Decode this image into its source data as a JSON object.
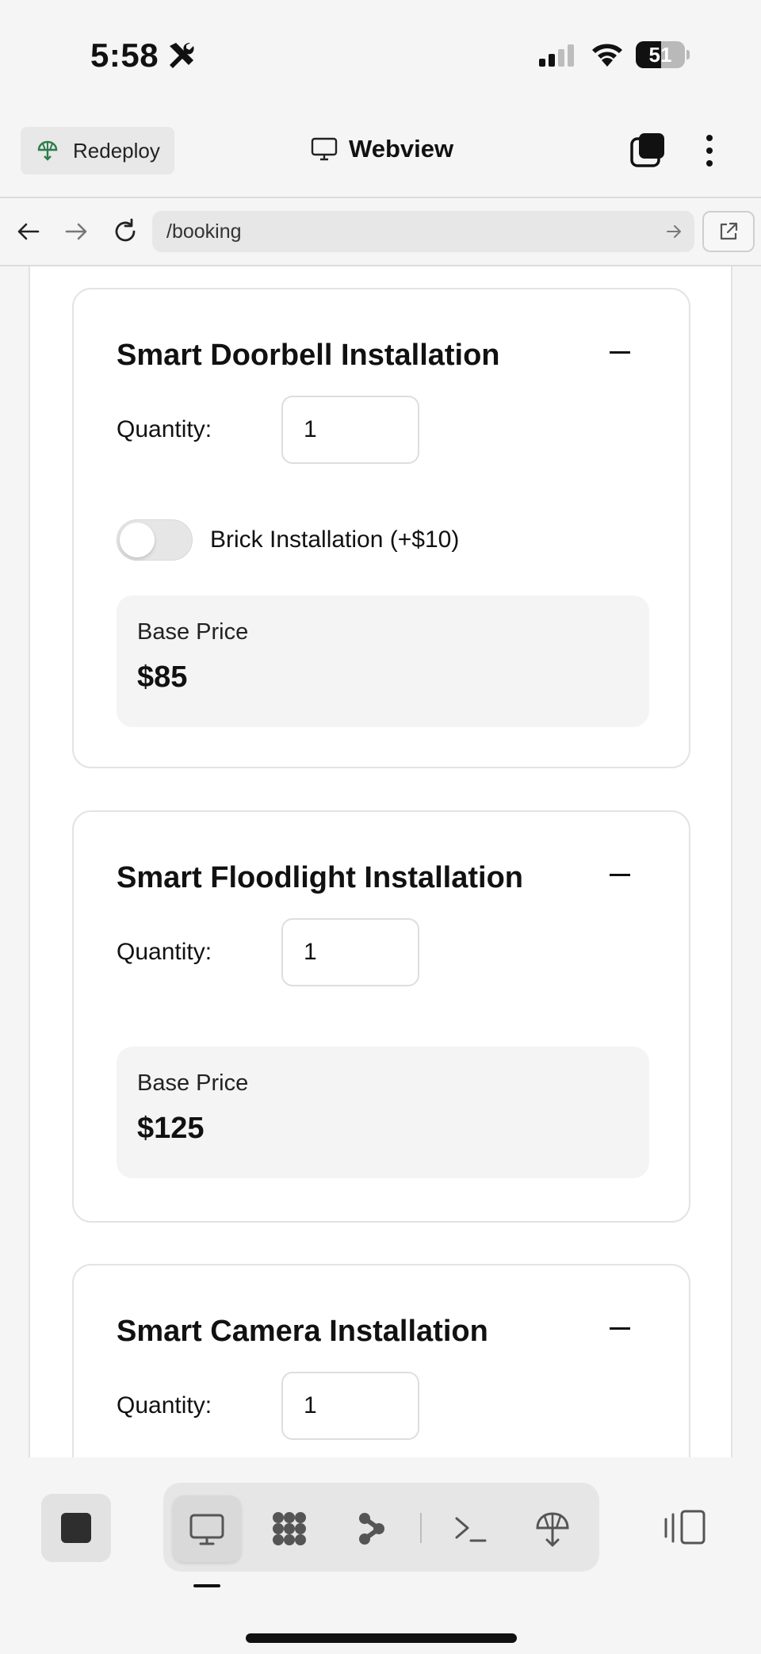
{
  "status_bar": {
    "time": "5:58",
    "battery": "51",
    "battery_level_percent": 51
  },
  "header": {
    "redeploy_label": "Redeploy",
    "title": "Webview"
  },
  "url_bar": {
    "url": "/booking"
  },
  "services": [
    {
      "title": "Smart Doorbell Installation",
      "quantity_label": "Quantity:",
      "quantity": "1",
      "option_label": "Brick Installation (+$10)",
      "option_enabled": false,
      "price_label": "Base Price",
      "price": "$85"
    },
    {
      "title": "Smart Floodlight Installation",
      "quantity_label": "Quantity:",
      "quantity": "1",
      "price_label": "Base Price",
      "price": "$125"
    },
    {
      "title": "Smart Camera Installation",
      "quantity_label": "Quantity:",
      "quantity": "1"
    }
  ],
  "toolbar": {
    "tools": [
      "monitor-icon",
      "dots-grid-icon",
      "branch-icon",
      "terminal-icon",
      "deploy-icon"
    ],
    "active_tool": "monitor-icon"
  },
  "colors": {
    "background": "#f5f5f5",
    "card_border": "#e3e3e3",
    "price_box": "#f4f4f4",
    "redeploy_icon": "#2e7d4a"
  }
}
